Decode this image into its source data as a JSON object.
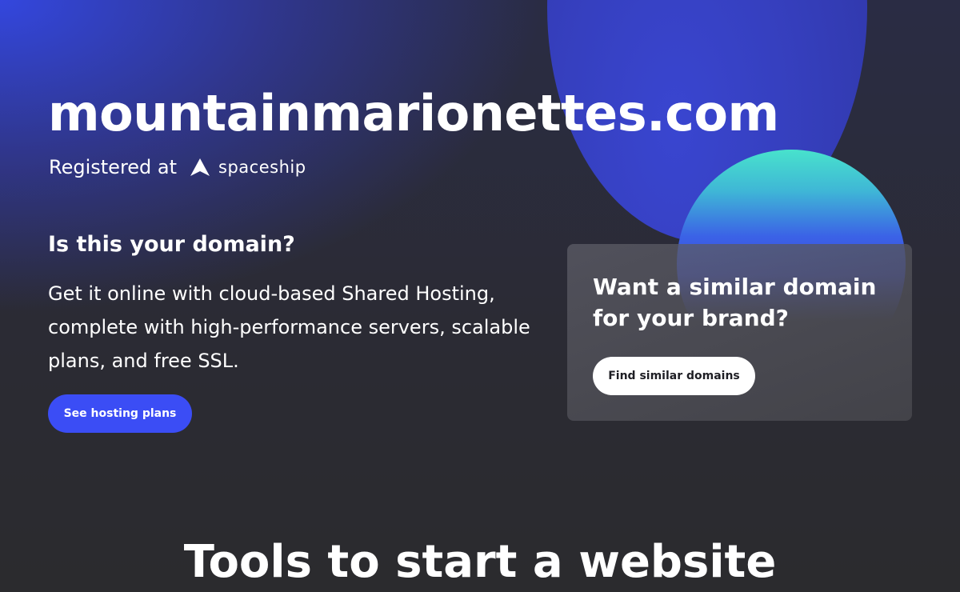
{
  "hero": {
    "domain": "mountainmarionettes.com",
    "registered_label": "Registered at",
    "registrar": {
      "name": "spaceship",
      "icon": "spaceship-logo-icon"
    }
  },
  "hosting": {
    "heading": "Is this your domain?",
    "description": "Get it online with cloud-based Shared Hosting, complete with high-performance servers, scalable plans, and free SSL.",
    "button_label": "See hosting plans"
  },
  "similar": {
    "heading": "Want a similar domain for your brand?",
    "button_label": "Find similar domains"
  },
  "tools": {
    "heading": "Tools to start a website"
  },
  "colors": {
    "primary_button": "#3b4df5",
    "background": "#2b2b2f",
    "accent_green": "#48e2cc",
    "accent_blue": "#3a47d8"
  }
}
